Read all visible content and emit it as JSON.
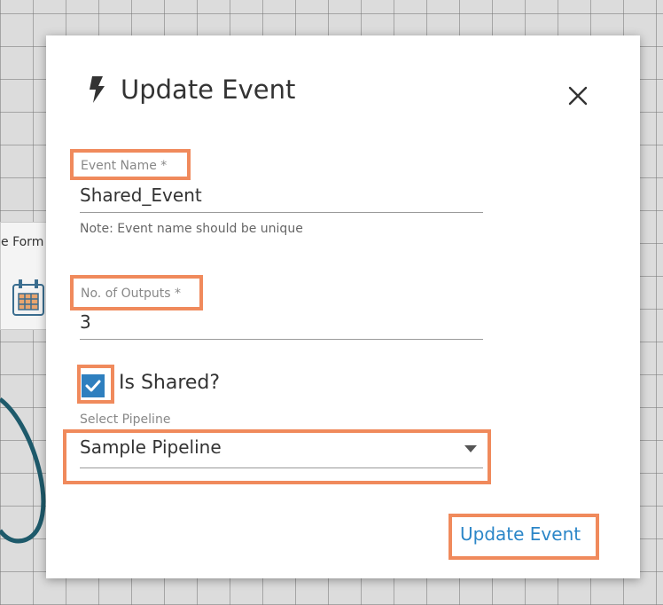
{
  "background": {
    "node_label": "e Form"
  },
  "dialog": {
    "title": "Update Event",
    "title_icon": "lightning-bolt-icon",
    "close_icon": "close-icon",
    "event_name": {
      "label": "Event Name *",
      "value": "Shared_Event",
      "note": "Note: Event name should be unique"
    },
    "outputs": {
      "label": "No. of Outputs *",
      "value": "3"
    },
    "is_shared": {
      "label": "Is Shared?",
      "checked": true
    },
    "pipeline": {
      "label": "Select Pipeline",
      "selected": "Sample Pipeline"
    },
    "submit_label": "Update Event"
  },
  "colors": {
    "highlight": "#f08a5c",
    "accent": "#2b86c8",
    "checkbox": "#2e7fbf"
  }
}
